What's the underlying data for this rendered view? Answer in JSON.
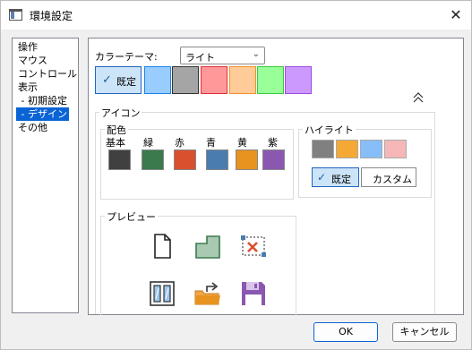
{
  "window": {
    "title": "環境設定",
    "close_glyph": "✕"
  },
  "nav": {
    "items": [
      {
        "label": "操作"
      },
      {
        "label": "マウス"
      },
      {
        "label": "コントロール"
      },
      {
        "label": "表示"
      },
      {
        "label": " - 初期設定"
      },
      {
        "label": " - デザイン",
        "selected": true
      },
      {
        "label": "その他"
      }
    ]
  },
  "color_theme": {
    "label": "カラーテーマ:",
    "selected_value": "ライト",
    "default_label": "既定",
    "check_glyph": "✓",
    "swatches": [
      {
        "color": "#99ccff",
        "border": "#1e82e6"
      },
      {
        "color": "#a5a5a5",
        "border": "#333333"
      },
      {
        "color": "#ff9999",
        "border": "#e0303a"
      },
      {
        "color": "#ffcc99",
        "border": "#f0902a"
      },
      {
        "color": "#99ff99",
        "border": "#3cc83c"
      },
      {
        "color": "#cc99ff",
        "border": "#9b4ae0"
      }
    ]
  },
  "icons_group": {
    "title": "アイコン",
    "palette": {
      "title": "配色",
      "colors": [
        {
          "label": "基本",
          "color": "#404040"
        },
        {
          "label": "緑",
          "color": "#3a7a4c"
        },
        {
          "label": "赤",
          "color": "#d9502f"
        },
        {
          "label": "青",
          "color": "#4a7cb0"
        },
        {
          "label": "黄",
          "color": "#e8921f"
        },
        {
          "label": "紫",
          "color": "#8a58b0"
        }
      ]
    },
    "highlight": {
      "title": "ハイライト",
      "colors": [
        "#808080",
        "#f5a935",
        "#88bef8",
        "#f5b7b7"
      ],
      "default_label": "既定",
      "custom_label": "カスタム",
      "check_glyph": "✓"
    },
    "preview": {
      "title": "プレビュー",
      "icons": [
        "new-document-icon",
        "layer-icon",
        "remove-selection-icon",
        "compare-panels-icon",
        "open-folder-icon",
        "save-icon"
      ]
    }
  },
  "buttons": {
    "ok": "OK",
    "cancel": "キャンセル"
  }
}
